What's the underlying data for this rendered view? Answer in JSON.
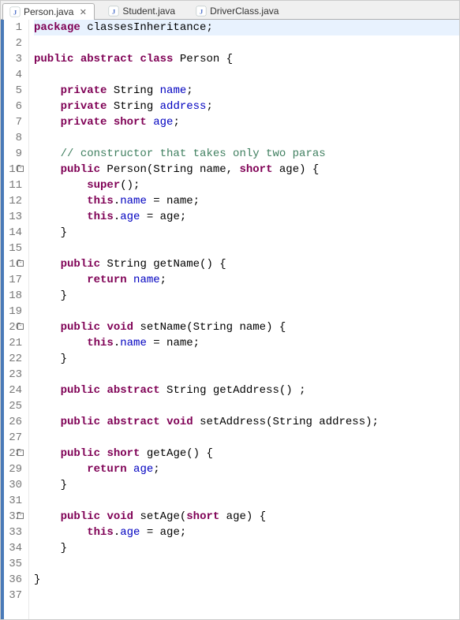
{
  "tabs": [
    {
      "label": "Person.java",
      "active": true,
      "closable": true
    },
    {
      "label": "Student.java",
      "active": false,
      "closable": false
    },
    {
      "label": "DriverClass.java",
      "active": false,
      "closable": false
    }
  ],
  "close_glyph": "✕",
  "lines": [
    {
      "n": "1",
      "marker": "",
      "hl": true,
      "html": "<span class='kw'>package</span> classesInheritance;"
    },
    {
      "n": "2",
      "marker": "",
      "hl": false,
      "html": ""
    },
    {
      "n": "3",
      "marker": "",
      "hl": false,
      "html": "<span class='kw'>public</span> <span class='kw'>abstract</span> <span class='kw'>class</span> Person {"
    },
    {
      "n": "4",
      "marker": "",
      "hl": false,
      "html": ""
    },
    {
      "n": "5",
      "marker": "",
      "hl": false,
      "html": "    <span class='kw'>private</span> String <span class='fld'>name</span>;"
    },
    {
      "n": "6",
      "marker": "",
      "hl": false,
      "html": "    <span class='kw'>private</span> String <span class='fld'>address</span>;"
    },
    {
      "n": "7",
      "marker": "",
      "hl": false,
      "html": "    <span class='kw'>private</span> <span class='kw'>short</span> <span class='fld'>age</span>;"
    },
    {
      "n": "8",
      "marker": "",
      "hl": false,
      "html": ""
    },
    {
      "n": "9",
      "marker": "",
      "hl": false,
      "html": "    <span class='cm'>// constructor that takes only two paras</span>"
    },
    {
      "n": "10",
      "marker": "⊖",
      "hl": false,
      "html": "    <span class='kw'>public</span> Person(String name, <span class='kw'>short</span> age) {"
    },
    {
      "n": "11",
      "marker": "",
      "hl": false,
      "html": "        <span class='kw'>super</span>();"
    },
    {
      "n": "12",
      "marker": "",
      "hl": false,
      "html": "        <span class='kw'>this</span>.<span class='fld'>name</span> = name;"
    },
    {
      "n": "13",
      "marker": "",
      "hl": false,
      "html": "        <span class='kw'>this</span>.<span class='fld'>age</span> = age;"
    },
    {
      "n": "14",
      "marker": "",
      "hl": false,
      "html": "    }"
    },
    {
      "n": "15",
      "marker": "",
      "hl": false,
      "html": ""
    },
    {
      "n": "16",
      "marker": "⊖",
      "hl": false,
      "html": "    <span class='kw'>public</span> String getName() {"
    },
    {
      "n": "17",
      "marker": "",
      "hl": false,
      "html": "        <span class='kw'>return</span> <span class='fld'>name</span>;"
    },
    {
      "n": "18",
      "marker": "",
      "hl": false,
      "html": "    }"
    },
    {
      "n": "19",
      "marker": "",
      "hl": false,
      "html": ""
    },
    {
      "n": "20",
      "marker": "⊖",
      "hl": false,
      "html": "    <span class='kw'>public</span> <span class='kw'>void</span> setName(String name) {"
    },
    {
      "n": "21",
      "marker": "",
      "hl": false,
      "html": "        <span class='kw'>this</span>.<span class='fld'>name</span> = name;"
    },
    {
      "n": "22",
      "marker": "",
      "hl": false,
      "html": "    }"
    },
    {
      "n": "23",
      "marker": "",
      "hl": false,
      "html": ""
    },
    {
      "n": "24",
      "marker": "",
      "hl": false,
      "html": "    <span class='kw'>public</span> <span class='kw'>abstract</span> String getAddress() ;"
    },
    {
      "n": "25",
      "marker": "",
      "hl": false,
      "html": ""
    },
    {
      "n": "26",
      "marker": "",
      "hl": false,
      "html": "    <span class='kw'>public</span> <span class='kw'>abstract</span> <span class='kw'>void</span> setAddress(String address);"
    },
    {
      "n": "27",
      "marker": "",
      "hl": false,
      "html": ""
    },
    {
      "n": "28",
      "marker": "⊖",
      "hl": false,
      "html": "    <span class='kw'>public</span> <span class='kw'>short</span> getAge() {"
    },
    {
      "n": "29",
      "marker": "",
      "hl": false,
      "html": "        <span class='kw'>return</span> <span class='fld'>age</span>;"
    },
    {
      "n": "30",
      "marker": "",
      "hl": false,
      "html": "    }"
    },
    {
      "n": "31",
      "marker": "",
      "hl": false,
      "html": ""
    },
    {
      "n": "32",
      "marker": "⊖",
      "hl": false,
      "html": "    <span class='kw'>public</span> <span class='kw'>void</span> setAge(<span class='kw'>short</span> age) {"
    },
    {
      "n": "33",
      "marker": "",
      "hl": false,
      "html": "        <span class='kw'>this</span>.<span class='fld'>age</span> = age;"
    },
    {
      "n": "34",
      "marker": "",
      "hl": false,
      "html": "    }"
    },
    {
      "n": "35",
      "marker": "",
      "hl": false,
      "html": ""
    },
    {
      "n": "36",
      "marker": "",
      "hl": false,
      "html": "}"
    },
    {
      "n": "37",
      "marker": "",
      "hl": false,
      "html": ""
    }
  ]
}
